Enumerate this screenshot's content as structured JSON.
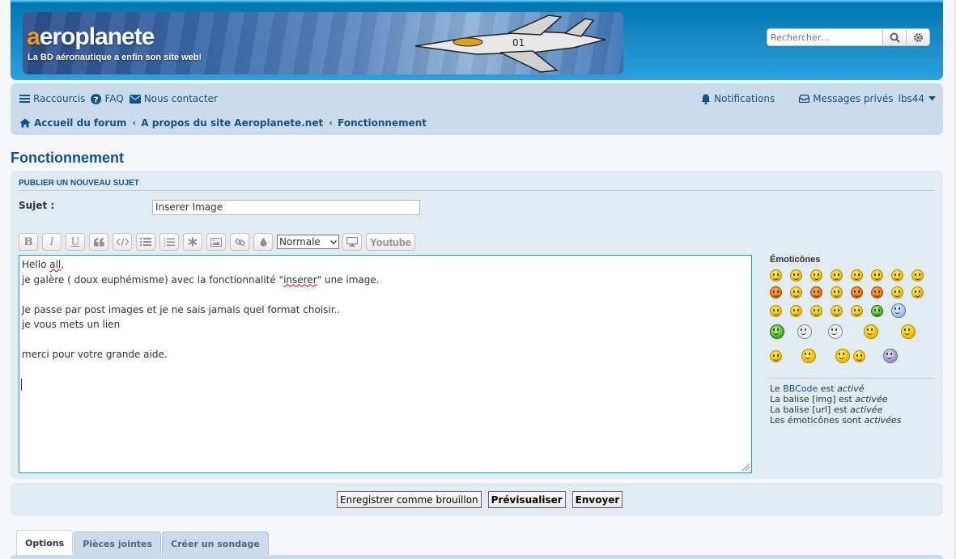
{
  "header": {
    "logo_prefix": "a",
    "logo_rest": "eroplanete",
    "tagline": "La BD aéronautique a enfin son site web!",
    "search_placeholder": "Rechercher…"
  },
  "nav": {
    "shortcuts": "Raccourcis",
    "faq": "FAQ",
    "contact": "Nous contacter",
    "notifications": "Notifications",
    "messages": "Messages privés",
    "username": "lbs44"
  },
  "breadcrumb": {
    "home": "Accueil du forum",
    "section": "A propos du site Aeroplanete.net",
    "forum": "Fonctionnement"
  },
  "page_title": "Fonctionnement",
  "post_form": {
    "heading": "Publier un nouveau sujet",
    "subject_label": "Sujet :",
    "subject_value": "Inserer Image",
    "font_size": "Normale",
    "youtube_label": "Youtube",
    "message_lines": [
      "Hello all,",
      "je galère ( doux euphémisme) avec la fonctionnalité \"inserer\" une image.",
      "",
      "Je passe par post images et je ne sais jamais quel format choisir..",
      "je vous mets un lien",
      "",
      "merci pour votre grande aide."
    ],
    "msg": {
      "l1a": "Hello ",
      "l1b": "all",
      "l1c": ",",
      "l2a": "je galère ( doux euphémisme) avec la fonctionnalité \"",
      "l2b": "inserer",
      "l2c": "\" une image.",
      "l4": "Je passe par post images et je ne sais jamais quel format choisir..",
      "l5": "je vous mets un lien",
      "l7": "merci pour votre grande aide."
    }
  },
  "side": {
    "smilies_title": "Émoticônes",
    "bbcode_pre": "Le ",
    "bbcode_link": "BBCode",
    "bbcode_mid": " est ",
    "bbcode_state": "activé",
    "img_pre": "La balise [img] est ",
    "img_state": "activée",
    "url_pre": "La balise [url] est ",
    "url_state": "activée",
    "smilies_pre": "Les émoticônes sont ",
    "smilies_state": "activées"
  },
  "buttons": {
    "draft": "Enregistrer comme brouillon",
    "preview": "Prévisualiser",
    "submit": "Envoyer"
  },
  "tabs": [
    "Options",
    "Pièces jointes",
    "Créer un sondage"
  ],
  "colors": {
    "header_blue": "#1f8ec9",
    "nav_bg": "#cadceb",
    "panel_bg": "#e1ebf2",
    "link": "#105289"
  }
}
